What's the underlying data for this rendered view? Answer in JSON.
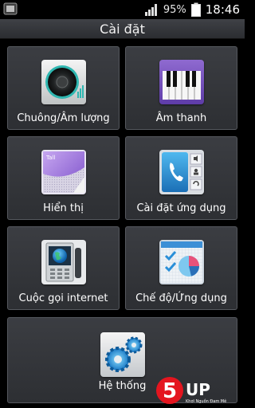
{
  "status": {
    "battery_percent": "95%",
    "time": "18:46",
    "icons": [
      "notification-icon",
      "signal-icon",
      "battery-icon"
    ]
  },
  "title": "Cài đặt",
  "tiles": [
    {
      "label": "Chuông/Âm lượng",
      "icon": "speaker-icon"
    },
    {
      "label": "Âm thanh",
      "icon": "piano-icon"
    },
    {
      "label": "Hiển thị",
      "icon": "display-icon"
    },
    {
      "label": "Cài đặt ứng dụng",
      "icon": "phone-settings-icon"
    },
    {
      "label": "Cuộc gọi internet",
      "icon": "internet-call-icon"
    },
    {
      "label": "Chế độ/Ứng dụng",
      "icon": "mode-apps-icon"
    },
    {
      "label": "Hệ thống",
      "icon": "gears-icon"
    }
  ],
  "watermark": {
    "brand": "5UP",
    "tagline": "Khơi Nguồn Đam Mê"
  },
  "colors": {
    "background": "#000000",
    "tile": "#35373b",
    "tile_border": "#55585e",
    "accent_blue": "#2a8fd8"
  }
}
